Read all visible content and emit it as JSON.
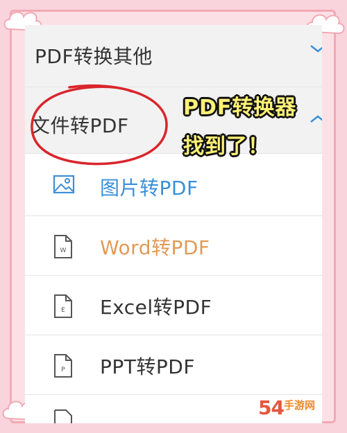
{
  "menu": {
    "section_other": "PDF转换其他",
    "section_file": "文件转PDF",
    "items": [
      {
        "label": "图片转PDF",
        "icon": "image-icon",
        "color": "#3b8fd6"
      },
      {
        "label": "Word转PDF",
        "icon": "word-file-icon",
        "color": "#e19a57"
      },
      {
        "label": "Excel转PDF",
        "icon": "excel-file-icon",
        "color": "#333333"
      },
      {
        "label": "PPT转PDF",
        "icon": "ppt-file-icon",
        "color": "#333333"
      }
    ],
    "file_icon_letters": [
      "W",
      "E",
      "P"
    ]
  },
  "annotation": {
    "line1": "PDF转换器",
    "line2": "找到了！",
    "circle_color": "#d9252c"
  },
  "watermark": {
    "text": "54",
    "sub": "手游网"
  },
  "colors": {
    "background": "#f9d4dc",
    "border": "#f3a9b4",
    "caption": "#fff176"
  }
}
